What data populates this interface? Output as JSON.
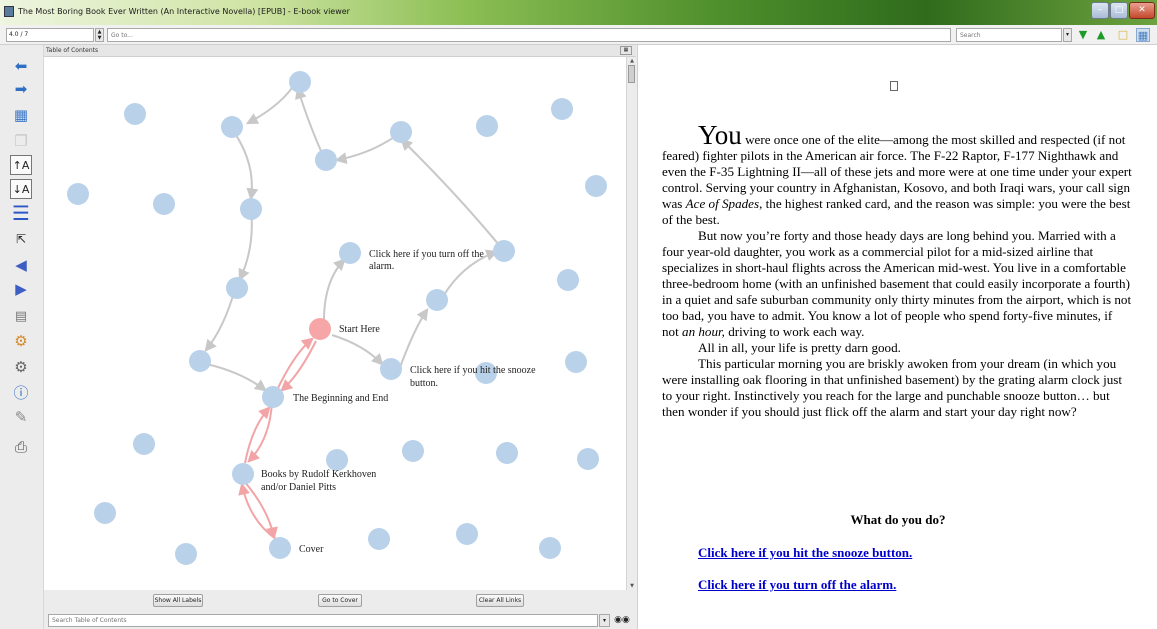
{
  "window": {
    "title": "The Most Boring Book Ever Written (An Interactive Novella) [EPUB] - E-book viewer",
    "controls": [
      "minimize",
      "maximize",
      "close"
    ]
  },
  "toolbar": {
    "page_position": "4.0 / 7",
    "goto_placeholder": "Go to...",
    "search_placeholder": "Search",
    "icons": [
      "search-dropdown",
      "next-match-down-arrow",
      "previous-match-up-arrow",
      "bookmark-page",
      "toggle-panel"
    ]
  },
  "left_toolbar": {
    "icons": [
      "back-arrow",
      "forward-arrow",
      "bookmarks",
      "copy",
      "font-larger",
      "font-smaller",
      "table-of-contents",
      "fullscreen",
      "previous-section",
      "next-section",
      "reference-mode",
      "preferences",
      "settings",
      "info",
      "lookup",
      "print"
    ]
  },
  "toc": {
    "header": "Table of Contents",
    "buttons": {
      "show_labels": "Show All Labels",
      "go_to_cover": "Go to Cover",
      "clear_links": "Clear All Links"
    },
    "search_placeholder": "Search Table of Contents",
    "colors": {
      "node": "#b9d2ea",
      "active_node": "#f7a6a8",
      "edge": "#c8c8c8",
      "active_edge": "#f2a4a6"
    },
    "labels": {
      "start": "Start Here",
      "turn_off": "Click here if you turn off the alarm.",
      "snooze": "Click here if you hit the snooze button.",
      "beginning_end": "The Beginning and End",
      "books": "Books by Rudolf Kerkhoven and/or Daniel Pitts",
      "cover": "Cover"
    }
  },
  "book": {
    "dropcap": "You",
    "p1_rest": " were once one of the elite—among the most skilled and respected (if not feared) fighter pilots in the American air force.  The F-22 Raptor, F-177 Nighthawk and even the F-35 Lightning II—all of these jets and more were at one time under your expert control.  Serving your country in Afghanistan, Kosovo, and both Iraqi wars, your call sign was ",
    "p1_callsign": "Ace of Spades",
    "p1_end": ", the highest ranked card, and the reason was simple: you were the best of the best.",
    "p2_start": "But now you’re forty and those heady days are long behind you. Married with a four year-old daughter, you work as a commercial pilot for a mid-sized airline that specializes in short-haul flights across the American mid-west.  You live in a comfortable three-bedroom home (with an unfinished basement that could easily incorporate a fourth) in a quiet and safe suburban community only thirty minutes from the airport, which is not too bad, you have to admit.  You know a lot of people who spend forty-five minutes, if not ",
    "p2_em": "an hour,",
    "p2_end": " driving to work each way.",
    "p3": "All in all, your life is pretty darn good.",
    "p4": "This particular morning you are briskly awoken from your dream (in which you were installing oak flooring in that unfinished basement) by the grating alarm clock just to your right.  Instinctively you reach for the large and punchable snooze button… but then wonder if you should just flick off the alarm and start your day right now?",
    "question": "What do you do?",
    "choice_snooze": "Click here if you hit the snooze button.",
    "choice_alarm": "Click here if you turn off the alarm.",
    "link_color": "#0000cc"
  }
}
